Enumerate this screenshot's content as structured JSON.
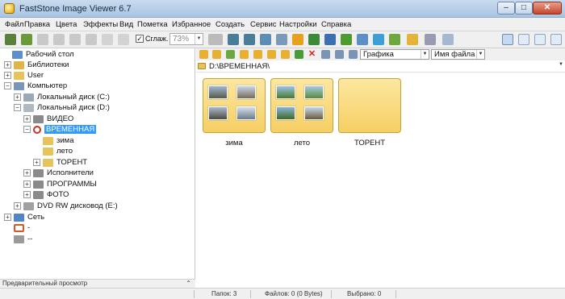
{
  "window": {
    "title": "FastStone Image Viewer 6.7",
    "min": "–",
    "max": "□",
    "close": "✕"
  },
  "menu": [
    "Файл",
    "Правка",
    "Цвета",
    "Эффекты",
    "Вид",
    "Пометка",
    "Избранное",
    "Создать",
    "Сервис",
    "Настройки",
    "Справка"
  ],
  "toolbar": {
    "smooth_label": "Сглаж.",
    "smooth_checked": "✓",
    "zoom_value": "73%"
  },
  "tree": {
    "items": [
      {
        "label": "Рабочий стол",
        "icon": "desktop-icon"
      },
      {
        "label": "Библиотеки",
        "icon": "libraries-icon"
      },
      {
        "label": "User",
        "icon": "user-folder-icon"
      },
      {
        "label": "Компьютер",
        "icon": "computer-icon"
      },
      {
        "label": "Локальный диск (C:)",
        "icon": "drive-icon"
      },
      {
        "label": "Локальный диск (D:)",
        "icon": "drive-icon"
      },
      {
        "label": "ВИДЕО",
        "icon": "folder-icon"
      },
      {
        "label": "ВРЕМЕННАЯ",
        "icon": "restricted-folder-icon"
      },
      {
        "label": "зима",
        "icon": "folder-icon"
      },
      {
        "label": "лето",
        "icon": "folder-icon"
      },
      {
        "label": "ТОРЕНТ",
        "icon": "folder-icon"
      },
      {
        "label": "Исполнители",
        "icon": "folder-icon"
      },
      {
        "label": "ПРОГРАММЫ",
        "icon": "folder-icon"
      },
      {
        "label": "ФОТО",
        "icon": "folder-icon"
      },
      {
        "label": "DVD RW дисковод (E:)",
        "icon": "dvd-drive-icon"
      },
      {
        "label": "Сеть",
        "icon": "network-icon"
      },
      {
        "label": "-",
        "icon": "control-panel-icon"
      },
      {
        "label": "--",
        "icon": "recycle-icon"
      }
    ],
    "preview_label": "Предварительный просмотр",
    "preview_toggle": "⌃"
  },
  "browser": {
    "filter_value": "Графика",
    "sort_value": "Имя файла",
    "path": "D:\\ВРЕМЕННАЯ\\",
    "thumbnails": [
      {
        "name": "зима"
      },
      {
        "name": "лето"
      },
      {
        "name": "ТОРЕНТ"
      }
    ]
  },
  "status": {
    "folders": "Папок: 3",
    "files": "Файлов: 0 (0 Bytes)",
    "selected": "Выбрано: 0"
  },
  "colors": {
    "selection": "#3399ff",
    "thumb_bg": "#f6cf64",
    "title_bg": "#b9d0ea"
  }
}
